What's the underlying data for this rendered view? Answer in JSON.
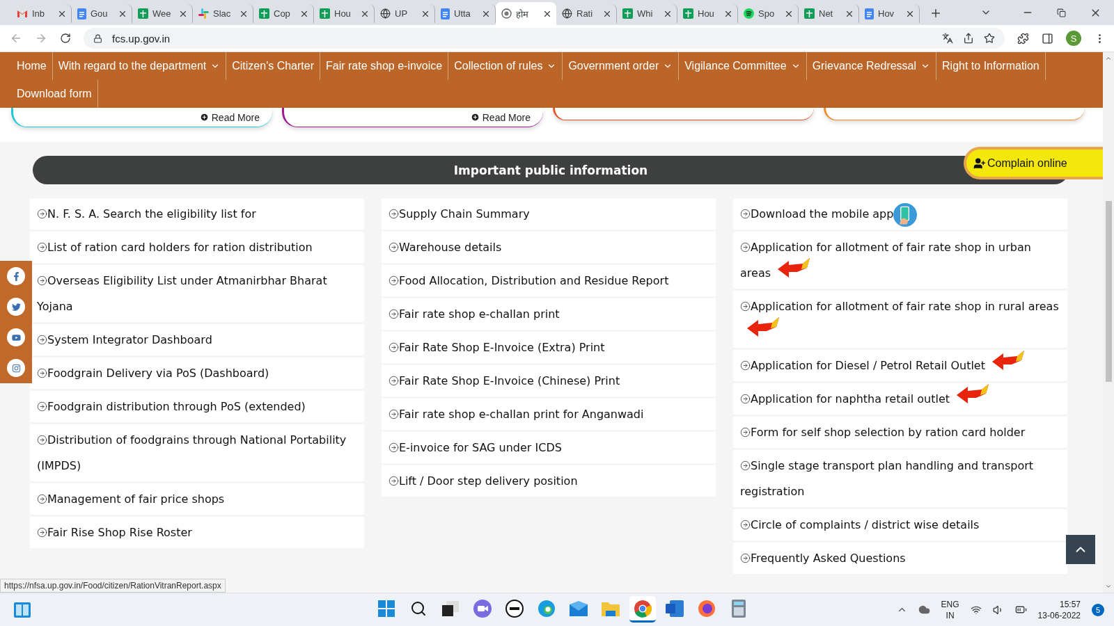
{
  "browser": {
    "tabs": [
      {
        "title": "Inb",
        "kind": "mail",
        "selected": false
      },
      {
        "title": "Gou",
        "kind": "doc",
        "selected": false
      },
      {
        "title": "Wee",
        "kind": "sheet",
        "selected": false
      },
      {
        "title": "Slac",
        "kind": "slack",
        "selected": false
      },
      {
        "title": "Cop",
        "kind": "sheet",
        "selected": false
      },
      {
        "title": "Hou",
        "kind": "sheet",
        "selected": false
      },
      {
        "title": "UP",
        "kind": "globe",
        "selected": false
      },
      {
        "title": "Utta",
        "kind": "doc",
        "selected": false
      },
      {
        "title": "होम",
        "kind": "emblem",
        "selected": true
      },
      {
        "title": "Rati",
        "kind": "globe",
        "selected": false
      },
      {
        "title": "Whi",
        "kind": "sheet",
        "selected": false
      },
      {
        "title": "Hou",
        "kind": "sheet",
        "selected": false
      },
      {
        "title": "Spo",
        "kind": "music",
        "selected": false
      },
      {
        "title": "Net",
        "kind": "sheet",
        "selected": false
      },
      {
        "title": "Hov",
        "kind": "doc",
        "selected": false
      }
    ],
    "address": "fcs.up.gov.in",
    "profile": "S"
  },
  "nav": [
    {
      "label": "Home",
      "dropdown": false
    },
    {
      "label": "With regard to the department",
      "dropdown": true
    },
    {
      "label": "Citizen's Charter",
      "dropdown": false
    },
    {
      "label": "Fair rate shop e-invoice",
      "dropdown": false
    },
    {
      "label": "Collection of rules",
      "dropdown": true
    },
    {
      "label": "Government order",
      "dropdown": true
    },
    {
      "label": "Vigilance Committee",
      "dropdown": true
    },
    {
      "label": "Grievance Redressal",
      "dropdown": true
    },
    {
      "label": "Right to Information",
      "dropdown": false
    },
    {
      "label": "Download form",
      "dropdown": false
    }
  ],
  "cards": [
    {
      "color": "#1fc8d8",
      "read_more": "Read More"
    },
    {
      "color": "#9c1a8e",
      "read_more": "Read More"
    },
    {
      "color": "#e8542a"
    },
    {
      "color": "#f08a24"
    }
  ],
  "section": {
    "title": "Important public information",
    "complain": "Complain online",
    "columns": [
      [
        {
          "text": "N. F. S. A. Search the eligibility list for",
          "kind": "plain"
        },
        {
          "text": "List of ration card holders for ration distribution",
          "kind": "plain"
        },
        {
          "text": "Overseas Eligibility List under Atmanirbhar Bharat Yojana",
          "kind": "plain"
        },
        {
          "text": "System Integrator Dashboard",
          "kind": "plain"
        },
        {
          "text": "Foodgrain Delivery via PoS (Dashboard)",
          "kind": "plain"
        },
        {
          "text": "Foodgrain distribution through PoS (extended)",
          "kind": "plain"
        },
        {
          "text": "Distribution of foodgrains through National Portability (IMPDS)",
          "kind": "plain"
        },
        {
          "text": "Management of fair price shops",
          "kind": "plain"
        },
        {
          "text": "Fair Rise Shop Rise Roster",
          "kind": "plain"
        }
      ],
      [
        {
          "text": "Supply Chain Summary",
          "kind": "plain"
        },
        {
          "text": "Warehouse details",
          "kind": "plain"
        },
        {
          "text": "Food Allocation, Distribution and Residue Report",
          "kind": "plain"
        },
        {
          "text": "Fair rate shop e-challan print",
          "kind": "plain"
        },
        {
          "text": "Fair Rate Shop E-Invoice (Extra) Print",
          "kind": "plain"
        },
        {
          "text": "Fair Rate Shop E-Invoice (Chinese) Print",
          "kind": "plain"
        },
        {
          "text": "Fair rate shop e-challan print for Anganwadi",
          "kind": "plain"
        },
        {
          "text": "E-invoice for SAG under ICDS",
          "kind": "plain"
        },
        {
          "text": "Lift / Door step delivery position",
          "kind": "plain"
        }
      ],
      [
        {
          "text": "Download the mobile app",
          "kind": "app"
        },
        {
          "text": "Application for allotment of fair rate shop in urban areas",
          "kind": "new"
        },
        {
          "text": "Application for allotment of fair rate shop in rural areas",
          "kind": "new"
        },
        {
          "text": "Application for Diesel / Petrol Retail Outlet",
          "kind": "new"
        },
        {
          "text": "Application for naphtha retail outlet",
          "kind": "new"
        },
        {
          "text": "Form for self shop selection by ration card holder",
          "kind": "plain"
        },
        {
          "text": "Single stage transport plan handling and transport registration",
          "kind": "plain"
        },
        {
          "text": "Circle of complaints / district wise details",
          "kind": "plain"
        },
        {
          "text": "Frequently Asked Questions",
          "kind": "plain"
        }
      ]
    ]
  },
  "status_url": "https://nfsa.up.gov.in/Food/citizen/RationVitranReport.aspx",
  "taskbar": {
    "apps": [
      {
        "kind": "start",
        "active": false
      },
      {
        "kind": "search",
        "active": false
      },
      {
        "kind": "taskview",
        "active": false
      },
      {
        "kind": "video",
        "active": false
      },
      {
        "kind": "dell",
        "active": false
      },
      {
        "kind": "edge",
        "active": false
      },
      {
        "kind": "mail",
        "active": false
      },
      {
        "kind": "folder",
        "active": false
      },
      {
        "kind": "chrome",
        "active": true
      },
      {
        "kind": "word",
        "active": false
      },
      {
        "kind": "firefox",
        "active": false
      },
      {
        "kind": "calculator",
        "active": false
      }
    ],
    "lang": "ENG",
    "region": "IN",
    "time": "15:57",
    "date": "13-06-2022",
    "notifications": "5"
  }
}
